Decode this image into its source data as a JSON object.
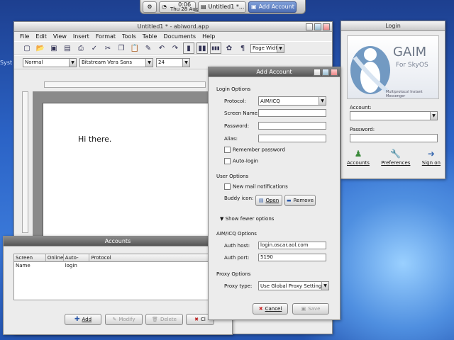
{
  "taskbar": {
    "clock_time": "0:06",
    "clock_date": "Thu 28 Aug",
    "buttons": [
      {
        "label": "Untitled1 *..."
      },
      {
        "label": "Add Account"
      }
    ]
  },
  "desktop": {
    "side_text": "Syst"
  },
  "abiword": {
    "title": "Untitled1 * - abiword.app",
    "menu": [
      "File",
      "Edit",
      "View",
      "Insert",
      "Format",
      "Tools",
      "Table",
      "Documents",
      "Help"
    ],
    "style_value": "Normal",
    "font_value": "Bitstream Vera Sans",
    "size_value": "24",
    "zoom_value": "Page Width",
    "body_text": "Hi there."
  },
  "login": {
    "title": "Login",
    "logo_name": "GAIM",
    "logo_sub": "For SkyOS",
    "logo_tagline": "Multiprotocol Instant Messenger",
    "account_label": "Account:",
    "password_label": "Password:",
    "buttons": [
      {
        "label": "Accounts"
      },
      {
        "label": "Preferences"
      },
      {
        "label": "Sign on"
      }
    ]
  },
  "add_account": {
    "title": "Add Account",
    "login_options": "Login Options",
    "protocol_label": "Protocol:",
    "protocol_value": "AIM/ICQ",
    "screen_name_label": "Screen Name:",
    "password_label": "Password:",
    "alias_label": "Alias:",
    "remember_password": "Remember password",
    "auto_login": "Auto-login",
    "user_options": "User Options",
    "new_mail": "New mail notifications",
    "buddy_icon_label": "Buddy icon:",
    "open_button": "Open",
    "remove_button": "Remove",
    "show_fewer": "Show fewer options",
    "aim_options": "AIM/ICQ Options",
    "auth_host_label": "Auth host:",
    "auth_host_value": "login.oscar.aol.com",
    "auth_port_label": "Auth port:",
    "auth_port_value": "5190",
    "proxy_options": "Proxy Options",
    "proxy_type_label": "Proxy type:",
    "proxy_type_value": "Use Global Proxy Settings",
    "cancel_button": "Cancel",
    "save_button": "Save"
  },
  "accounts": {
    "title": "Accounts",
    "columns": [
      "Screen Name",
      "Online",
      "Auto-login",
      "Protocol"
    ],
    "add_button": "Add",
    "modify_button": "Modify",
    "delete_button": "Delete",
    "close_button": "Cl"
  }
}
